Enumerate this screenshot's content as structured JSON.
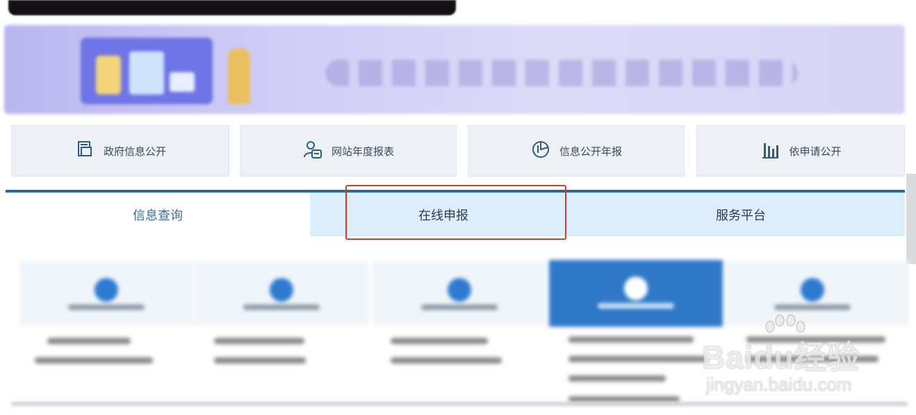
{
  "quick_links": [
    {
      "label": "政府信息公开",
      "icon": "document-icon"
    },
    {
      "label": "网站年度报表",
      "icon": "user-report-icon"
    },
    {
      "label": "信息公开年报",
      "icon": "pie-chart-icon"
    },
    {
      "label": "依申请公开",
      "icon": "bar-chart-icon"
    }
  ],
  "tabs": [
    {
      "label": "信息查询"
    },
    {
      "label": "在线申报"
    },
    {
      "label": "服务平台"
    }
  ],
  "active_tab": "在线申报",
  "colors": {
    "accent": "#2d6a98",
    "tab_active_bg": "#deedfb",
    "highlight_border": "#d23a32"
  },
  "watermark": {
    "logo": "Baidu经验",
    "url": "jingyan.baidu.com"
  }
}
